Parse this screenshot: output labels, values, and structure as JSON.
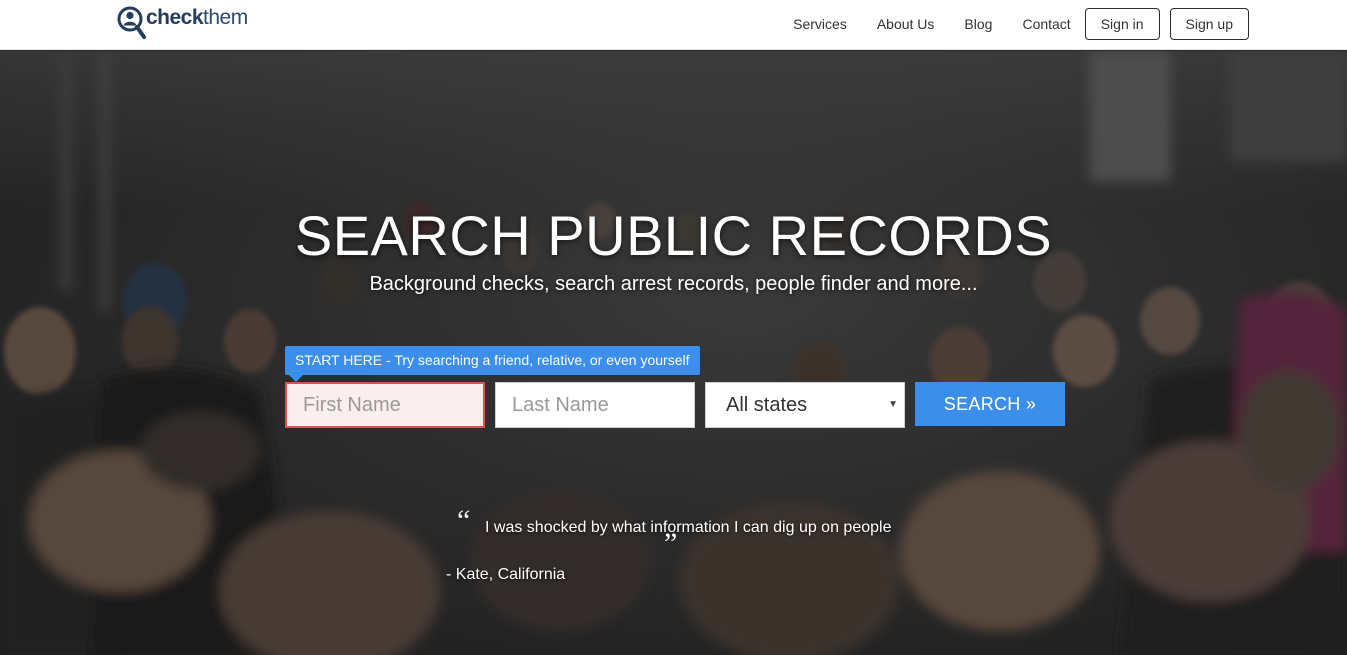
{
  "brand": {
    "logo_bold": "check",
    "logo_light": "them"
  },
  "nav": {
    "links": [
      "Services",
      "About Us",
      "Blog",
      "Contact"
    ],
    "sign_in": "Sign in",
    "sign_up": "Sign up"
  },
  "hero": {
    "title": "SEARCH PUBLIC RECORDS",
    "subtitle": "Background checks, search arrest records, people finder and more...",
    "hint": "START HERE - Try searching a friend, relative, or even yourself",
    "first_name_placeholder": "First Name",
    "last_name_placeholder": "Last Name",
    "state_selected": "All states",
    "search_label": "SEARCH »"
  },
  "testimonial": {
    "open_mark": "“",
    "close_mark": "”",
    "text": "I was shocked by what information I can dig up on people",
    "author": "- Kate, California"
  },
  "colors": {
    "accent": "#3b8eea",
    "brand": "#233d5e",
    "error_border": "#d9534f"
  },
  "icons": {
    "logo": "magnifier-person-icon",
    "select_caret": "caret-down-icon"
  }
}
